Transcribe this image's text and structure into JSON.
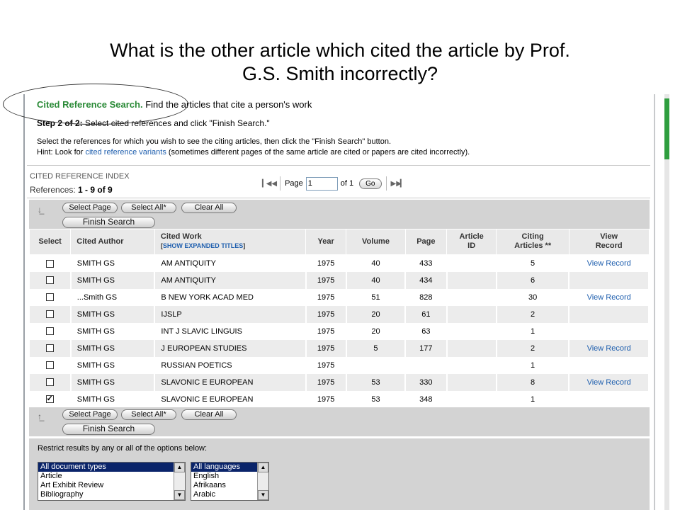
{
  "slide": {
    "title_line1": "What is the other article which cited the article by Prof.",
    "title_line2": "G.S. Smith incorrectly?"
  },
  "header": {
    "title": "Cited Reference Search.",
    "subtitle": "Find the articles that cite a person's work",
    "step_label": "Step 2 of 2:",
    "step_text": "Select cited references and click \"Finish Search.\"",
    "instruction": "Select the references for which you wish to see the citing articles, then click the \"Finish Search\" button.",
    "hint_prefix": "Hint: Look for ",
    "hint_link": "cited reference variants",
    "hint_suffix": " (sometimes different pages of the same article are cited or papers are cited incorrectly)."
  },
  "index": {
    "title": "CITED REFERENCE INDEX",
    "refs_label": "References:",
    "refs_value": "1 - 9 of  9"
  },
  "pager": {
    "page_label": "Page",
    "page_value": "1",
    "of_label": "of 1",
    "go_label": "Go",
    "first_icon": "first-page-icon",
    "prev_icon": "prev-page-icon",
    "next_icon": "next-page-icon",
    "last_icon": "last-page-icon"
  },
  "actions": {
    "select_page": "Select Page",
    "select_all": "Select All*",
    "clear_all": "Clear All",
    "finish_search": "Finish Search"
  },
  "table": {
    "headers": {
      "select": "Select",
      "author": "Cited Author",
      "work": "Cited Work",
      "work_link": "SHOW EXPANDED TITLES",
      "year": "Year",
      "volume": "Volume",
      "page": "Page",
      "article_id_1": "Article",
      "article_id_2": "ID",
      "citing_1": "Citing",
      "citing_2": "Articles **",
      "view_1": "View",
      "view_2": "Record"
    },
    "rows": [
      {
        "checked": false,
        "author": "SMITH GS",
        "work": "AM ANTIQUITY",
        "year": "1975",
        "volume": "40",
        "page": "433",
        "article_id": "",
        "citing": "5",
        "view": "View Record"
      },
      {
        "checked": false,
        "author": "SMITH GS",
        "work": "AM ANTIQUITY",
        "year": "1975",
        "volume": "40",
        "page": "434",
        "article_id": "",
        "citing": "6",
        "view": ""
      },
      {
        "checked": false,
        "author": "...Smith GS",
        "work": "B NEW YORK ACAD MED",
        "year": "1975",
        "volume": "51",
        "page": "828",
        "article_id": "",
        "citing": "30",
        "view": "View Record"
      },
      {
        "checked": false,
        "author": "SMITH GS",
        "work": "IJSLP",
        "year": "1975",
        "volume": "20",
        "page": "61",
        "article_id": "",
        "citing": "2",
        "view": ""
      },
      {
        "checked": false,
        "author": "SMITH GS",
        "work": "INT J SLAVIC LINGUIS",
        "year": "1975",
        "volume": "20",
        "page": "63",
        "article_id": "",
        "citing": "1",
        "view": ""
      },
      {
        "checked": false,
        "author": "SMITH GS",
        "work": "J EUROPEAN STUDIES",
        "year": "1975",
        "volume": "5",
        "page": "177",
        "article_id": "",
        "citing": "2",
        "view": "View Record"
      },
      {
        "checked": false,
        "author": "SMITH GS",
        "work": "RUSSIAN POETICS",
        "year": "1975",
        "volume": "",
        "page": "",
        "article_id": "",
        "citing": "1",
        "view": ""
      },
      {
        "checked": false,
        "author": "SMITH GS",
        "work": "SLAVONIC E EUROPEAN",
        "year": "1975",
        "volume": "53",
        "page": "330",
        "article_id": "",
        "citing": "8",
        "view": "View Record"
      },
      {
        "checked": true,
        "author": "SMITH GS",
        "work": "SLAVONIC E EUROPEAN",
        "year": "1975",
        "volume": "53",
        "page": "348",
        "article_id": "",
        "citing": "1",
        "view": ""
      }
    ]
  },
  "restrict": {
    "label": "Restrict results by any or all of the options below:",
    "doc_types": [
      "All document types",
      "Article",
      "Art Exhibit Review",
      "Bibliography"
    ],
    "languages": [
      "All languages",
      "English",
      "Afrikaans",
      "Arabic"
    ]
  },
  "colors": {
    "heading_green": "#2a8a37",
    "link_blue": "#1f5fae",
    "scroll_green": "#2f9e3f"
  }
}
